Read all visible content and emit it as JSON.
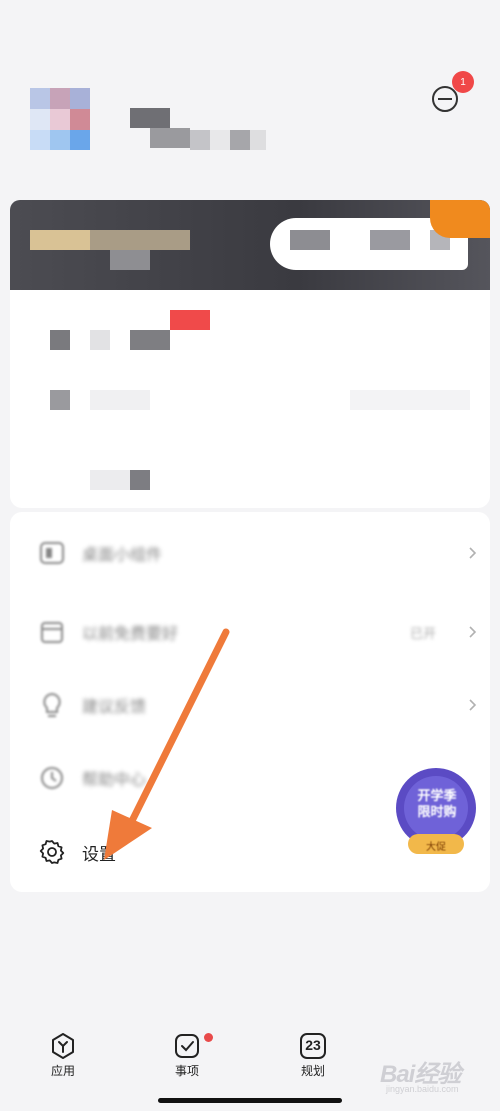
{
  "profile": {
    "avatar_alt": "用户头像",
    "name_hidden": true,
    "message_badge": "1"
  },
  "vip_banner": {
    "colors": {
      "dark": "#3f3f45",
      "accent": "#f08a1e"
    }
  },
  "menu": {
    "items": [
      {
        "key": "widget",
        "label": "桌面小组件",
        "icon": "widget-icon",
        "blurred": true
      },
      {
        "key": "reminder",
        "label": "以前免费要好",
        "value": "已开",
        "icon": "calendar-icon",
        "blurred": true
      },
      {
        "key": "feedback",
        "label": "建议反馈",
        "icon": "bulb-icon",
        "blurred": true
      },
      {
        "key": "help",
        "label": "帮助中心",
        "icon": "clock-icon",
        "blurred": true
      },
      {
        "key": "settings",
        "label": "设置",
        "icon": "gear-icon",
        "blurred": false
      }
    ]
  },
  "promo": {
    "line1": "开学季",
    "line2": "限时购",
    "line3": "大促"
  },
  "nav": {
    "items": [
      {
        "label": "应用",
        "icon": "apps-icon"
      },
      {
        "label": "事项",
        "icon": "check-icon",
        "dot": true
      },
      {
        "label": "规划",
        "icon": "calendar-day-icon",
        "day": "23"
      }
    ]
  },
  "watermark": {
    "text": "Bai经验",
    "sub": "jingyan.baidu.com"
  },
  "theme": {
    "accent": "#f08a1e",
    "badge": "#f04848",
    "arrow": "#ef7a3a"
  }
}
